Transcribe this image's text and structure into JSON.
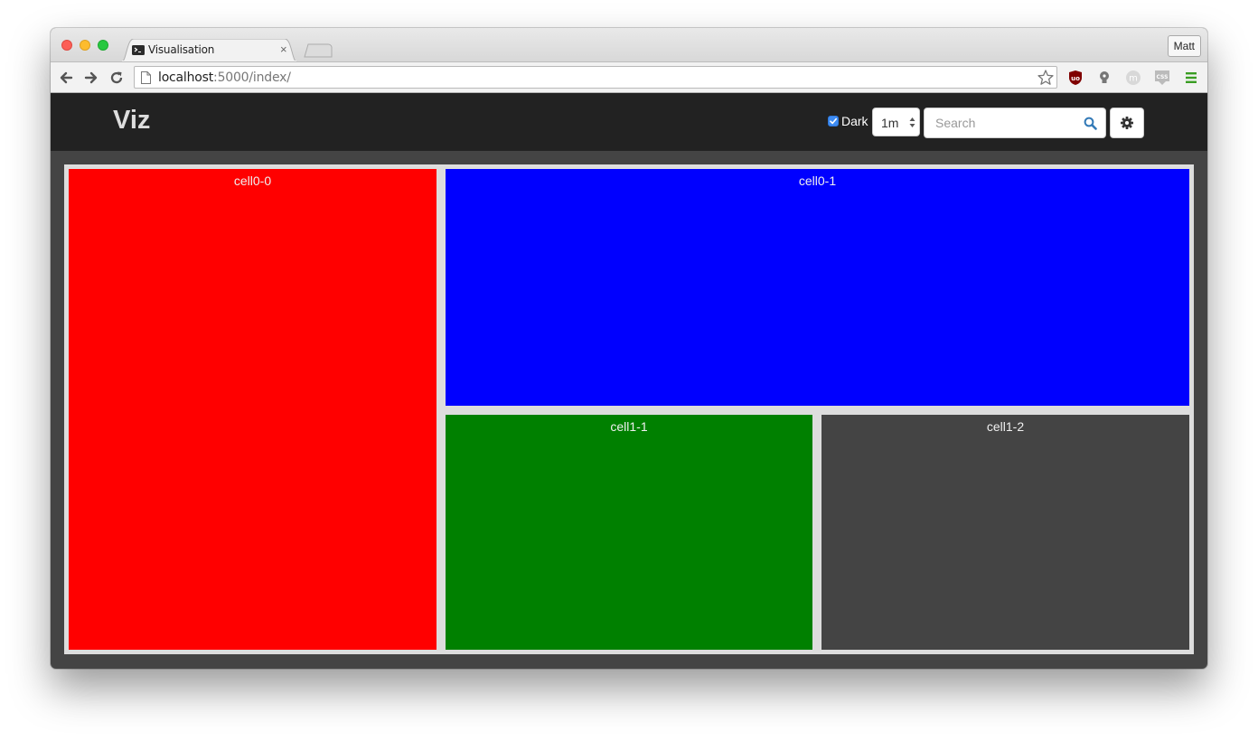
{
  "browser": {
    "tab_title": "Visualisation",
    "tab_close": "×",
    "profile_name": "Matt",
    "url_host": "localhost",
    "url_rest": ":5000/index/"
  },
  "app": {
    "brand": "Viz",
    "dark_label": "Dark",
    "dark_checked": true,
    "interval_value": "1m",
    "search_placeholder": "Search",
    "accent_color": "#337ab7"
  },
  "cells": [
    {
      "id": "cell0-0",
      "label": "cell0-0",
      "color": "#ff0000"
    },
    {
      "id": "cell0-1",
      "label": "cell0-1",
      "color": "#0000ff"
    },
    {
      "id": "cell1-1",
      "label": "cell1-1",
      "color": "#008000"
    },
    {
      "id": "cell1-2",
      "label": "cell1-2",
      "color": "#444444"
    }
  ],
  "icons": {
    "extensions": [
      "ublock-icon",
      "lightbulb-icon",
      "m-icon",
      "css-icon",
      "menu-icon"
    ]
  }
}
